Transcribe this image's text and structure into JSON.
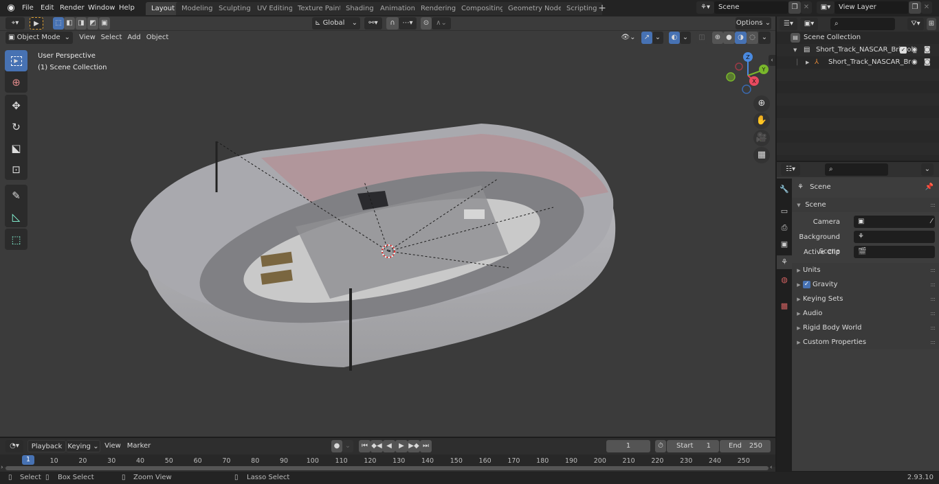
{
  "topbar": {
    "menus": [
      "File",
      "Edit",
      "Render",
      "Window",
      "Help"
    ],
    "workspaces": [
      "Layout",
      "Modeling",
      "Sculpting",
      "UV Editing",
      "Texture Paint",
      "Shading",
      "Animation",
      "Rendering",
      "Compositing",
      "Geometry Nodes",
      "Scripting"
    ],
    "active_workspace": "Layout",
    "add_workspace": "+",
    "scene_name": "Scene",
    "view_layer_name": "View Layer"
  },
  "viewport": {
    "mode": "Object Mode",
    "menus": [
      "View",
      "Select",
      "Add",
      "Object"
    ],
    "transform_orientation": "Global",
    "options_label": "Options",
    "overlay_title": "User Perspective",
    "overlay_subtitle": "(1) Scene Collection",
    "gizmo_axes": {
      "x": "X",
      "y": "Y",
      "z": "Z"
    },
    "tools": [
      "select-box",
      "cursor",
      "move",
      "rotate",
      "scale",
      "transform",
      "annotate",
      "measure",
      "add-cube"
    ],
    "nav_buttons": [
      "zoom",
      "pan",
      "camera",
      "ortho-grid"
    ],
    "accent": "#4772b3"
  },
  "outliner": {
    "search_placeholder": "",
    "root": "Scene Collection",
    "items": [
      {
        "name": "Short_Track_NASCAR_Bristol_",
        "type": "collection",
        "expanded": true,
        "checked": true
      },
      {
        "name": "Short_Track_NASCAR_Br",
        "type": "object",
        "expanded": false
      }
    ]
  },
  "properties": {
    "search_placeholder": "",
    "context_title": "Scene",
    "section_title": "Scene",
    "fields": [
      {
        "label": "Camera",
        "value": ""
      },
      {
        "label": "Background Scene",
        "value": ""
      },
      {
        "label": "Active Clip",
        "value": ""
      }
    ],
    "panels": [
      {
        "label": "Units"
      },
      {
        "label": "Gravity",
        "checkbox": true
      },
      {
        "label": "Keying Sets"
      },
      {
        "label": "Audio"
      },
      {
        "label": "Rigid Body World"
      },
      {
        "label": "Custom Properties"
      }
    ]
  },
  "timeline": {
    "menus": [
      "Playback",
      "Keying",
      "View",
      "Marker"
    ],
    "current_frame": "1",
    "start_label": "Start",
    "start": "1",
    "end_label": "End",
    "end": "250",
    "playhead": "1",
    "ticks": [
      "10",
      "20",
      "30",
      "40",
      "50",
      "60",
      "70",
      "80",
      "90",
      "100",
      "110",
      "120",
      "130",
      "140",
      "150",
      "160",
      "170",
      "180",
      "190",
      "200",
      "210",
      "220",
      "230",
      "240",
      "250"
    ]
  },
  "statusbar": {
    "hints": [
      "Select",
      "Box Select",
      "Zoom View",
      "Lasso Select"
    ],
    "version": "2.93.10"
  }
}
